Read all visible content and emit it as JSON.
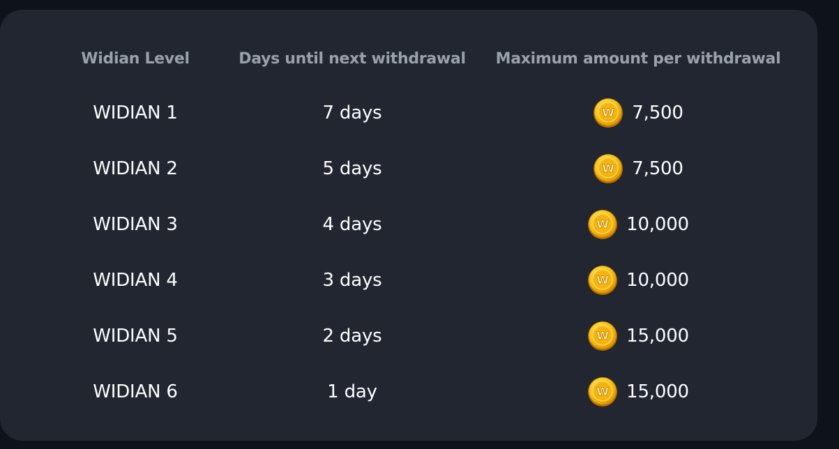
{
  "table": {
    "headers": {
      "level": "Widian Level",
      "days": "Days until next withdrawal",
      "maximum": "Maximum amount per withdrawal"
    },
    "coin_icon": "gold-w-coin-icon",
    "coin_letter": "W",
    "colors": {
      "background": "#0e131b",
      "card": "#212630",
      "header_text": "#9aa1ac",
      "cell_text": "#ffffff",
      "coin_gold": "#f5b800"
    },
    "rows": [
      {
        "level": "WIDIAN 1",
        "days": "7 days",
        "amount": "7,500"
      },
      {
        "level": "WIDIAN 2",
        "days": "5 days",
        "amount": "7,500"
      },
      {
        "level": "WIDIAN 3",
        "days": "4 days",
        "amount": "10,000"
      },
      {
        "level": "WIDIAN 4",
        "days": "3 days",
        "amount": "10,000"
      },
      {
        "level": "WIDIAN 5",
        "days": "2 days",
        "amount": "15,000"
      },
      {
        "level": "WIDIAN 6",
        "days": "1 day",
        "amount": "15,000"
      }
    ]
  }
}
